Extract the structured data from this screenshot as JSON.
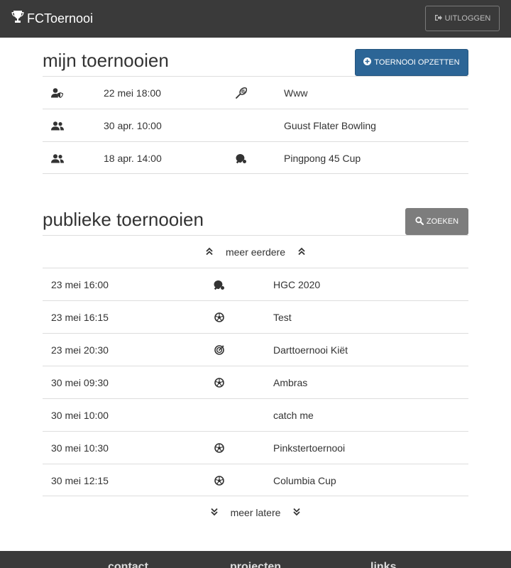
{
  "navbar": {
    "brand": "FCToernooi",
    "logout_label": "UITLOGGEN"
  },
  "my_tournaments": {
    "title": "mijn toernooien",
    "create_button": "TOERNOOI OPZETTEN",
    "rows": [
      {
        "role_icon": "user-shield-icon",
        "date": "22 mei 18:00",
        "sport_icon": "badminton-icon",
        "name": "Www"
      },
      {
        "role_icon": "users-icon",
        "date": "30 apr. 10:00",
        "sport_icon": "",
        "name": "Guust Flater Bowling"
      },
      {
        "role_icon": "users-icon",
        "date": "18 apr. 14:00",
        "sport_icon": "table-tennis-icon",
        "name": "Pingpong 45 Cup"
      }
    ]
  },
  "public_tournaments": {
    "title": "publieke toernooien",
    "search_button": "ZOEKEN",
    "earlier_label": "meer eerdere",
    "later_label": "meer latere",
    "rows": [
      {
        "date": "23 mei 16:00",
        "sport_icon": "table-tennis-icon",
        "name": "HGC 2020"
      },
      {
        "date": "23 mei 16:15",
        "sport_icon": "football-icon",
        "name": "Test"
      },
      {
        "date": "23 mei 20:30",
        "sport_icon": "darts-icon",
        "name": "Darttoernooi Kiët"
      },
      {
        "date": "30 mei 09:30",
        "sport_icon": "football-icon",
        "name": "Ambras"
      },
      {
        "date": "30 mei 10:00",
        "sport_icon": "",
        "name": "catch me"
      },
      {
        "date": "30 mei 10:30",
        "sport_icon": "football-icon",
        "name": "Pinkstertoernooi"
      },
      {
        "date": "30 mei 12:15",
        "sport_icon": "football-icon",
        "name": "Columbia Cup"
      }
    ]
  },
  "footer": {
    "col1": "contact",
    "col2": "projecten",
    "col3": "links"
  },
  "colors": {
    "navbar": "#3a3a3a",
    "primary": "#2c6596",
    "search": "#7d7d7d"
  }
}
